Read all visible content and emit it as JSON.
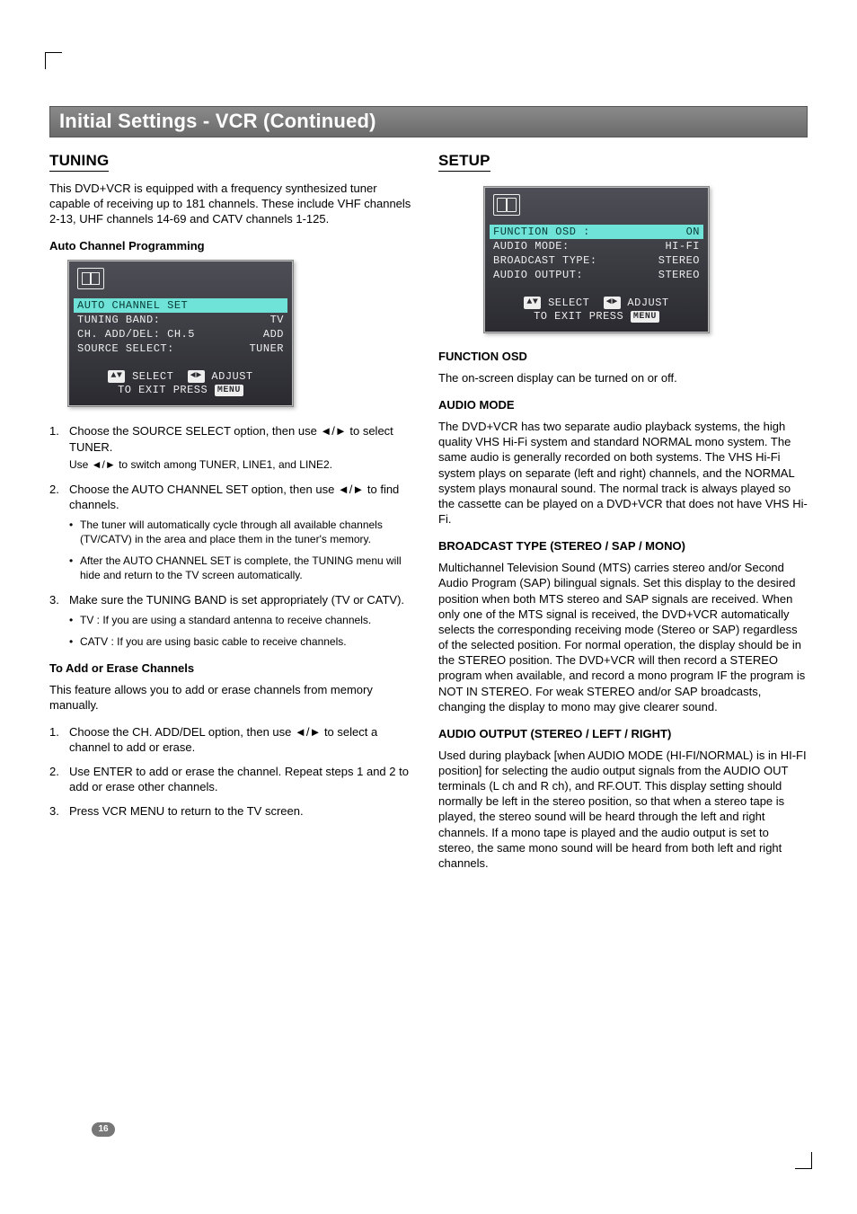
{
  "page_number": "16",
  "title": "Initial Settings - VCR (Continued)",
  "left": {
    "heading": "TUNING",
    "intro": "This DVD+VCR is equipped with a frequency synthesized tuner capable of receiving up to 181 channels. These include VHF channels 2-13, UHF channels 14-69 and CATV channels 1-125.",
    "sub1": "Auto Channel Programming",
    "osd": {
      "row_hl_label": "AUTO CHANNEL SET",
      "rows": [
        {
          "label": "TUNING BAND:",
          "value": "TV"
        },
        {
          "label": "CH. ADD/DEL: CH.5",
          "value": "ADD"
        },
        {
          "label": "SOURCE SELECT:",
          "value": "TUNER"
        }
      ],
      "foot1_select": "SELECT",
      "foot1_adjust": "ADJUST",
      "foot2_a": "TO EXIT PRESS",
      "foot2_b": "MENU"
    },
    "steps1": [
      {
        "n": "1.",
        "text": "Choose the SOURCE SELECT option, then use ◄/► to select TUNER.",
        "small": "Use ◄/► to switch among TUNER, LINE1, and LINE2."
      },
      {
        "n": "2.",
        "text": "Choose the AUTO CHANNEL SET option, then use ◄/► to find channels.",
        "bullets": [
          "The tuner will automatically cycle through all available channels (TV/CATV) in the area and place them in the tuner's memory.",
          "After the AUTO CHANNEL SET is complete, the TUNING menu will hide and return to the TV screen automatically."
        ]
      },
      {
        "n": "3.",
        "text": "Make sure the TUNING BAND is set appropriately (TV or CATV).",
        "bullets": [
          "TV : If you are using a standard antenna to receive channels.",
          "CATV : If you are using basic cable to receive channels."
        ]
      }
    ],
    "sub2": "To Add or Erase Channels",
    "sub2_intro": "This feature allows you to add or erase channels from memory manually.",
    "steps2": [
      {
        "n": "1.",
        "text": "Choose the CH. ADD/DEL option, then use ◄/► to select a channel to add or erase."
      },
      {
        "n": "2.",
        "text": "Use ENTER to add or erase the channel. Repeat steps 1 and 2 to add or erase other channels."
      },
      {
        "n": "3.",
        "text": "Press VCR MENU to return to the TV screen."
      }
    ]
  },
  "right": {
    "heading": "SETUP",
    "osd": {
      "row_hl_label": "FUNCTION OSD :",
      "row_hl_value": "ON",
      "rows": [
        {
          "label": "AUDIO MODE:",
          "value": "HI-FI"
        },
        {
          "label": "BROADCAST TYPE:",
          "value": "STEREO"
        },
        {
          "label": "AUDIO OUTPUT:",
          "value": "STEREO"
        }
      ],
      "foot1_select": "SELECT",
      "foot1_adjust": "ADJUST",
      "foot2_a": "TO EXIT PRESS",
      "foot2_b": "MENU"
    },
    "s1_h": "FUNCTION OSD",
    "s1_p": "The on-screen display can be turned on or off.",
    "s2_h": "AUDIO MODE",
    "s2_p": "The DVD+VCR has two separate audio playback systems, the high quality VHS Hi-Fi system and standard NORMAL mono system. The same audio is generally recorded on both systems. The VHS Hi-Fi system plays on separate (left and right) channels, and the NORMAL system plays monaural sound. The normal track is always played so the cassette can be played on a DVD+VCR that does not have VHS Hi-Fi.",
    "s3_h": "BROADCAST TYPE (STEREO / SAP / MONO)",
    "s3_p": "Multichannel Television Sound (MTS) carries stereo and/or Second Audio Program (SAP) bilingual signals. Set this display to the desired position when both MTS stereo and SAP signals are received. When only one of the MTS signal is received, the DVD+VCR automatically selects the corresponding receiving mode (Stereo or SAP) regardless of the selected position. For normal operation, the display should be in the STEREO position. The DVD+VCR will then record a STEREO program when available, and record a mono program IF the program is NOT IN STEREO. For weak STEREO and/or SAP broadcasts, changing the display to mono may give clearer sound.",
    "s4_h": "AUDIO OUTPUT (STEREO / LEFT / RIGHT)",
    "s4_p": "Used during playback [when AUDIO MODE (HI-FI/NORMAL) is in HI-FI position] for selecting the audio output signals from the AUDIO OUT terminals (L ch and R ch), and RF.OUT. This display setting should normally be left in the stereo position, so that when a stereo tape is played, the stereo sound will be heard through the left and right channels. If a mono tape is played and the audio output is set to stereo, the same mono sound will be heard from both left and right channels."
  }
}
